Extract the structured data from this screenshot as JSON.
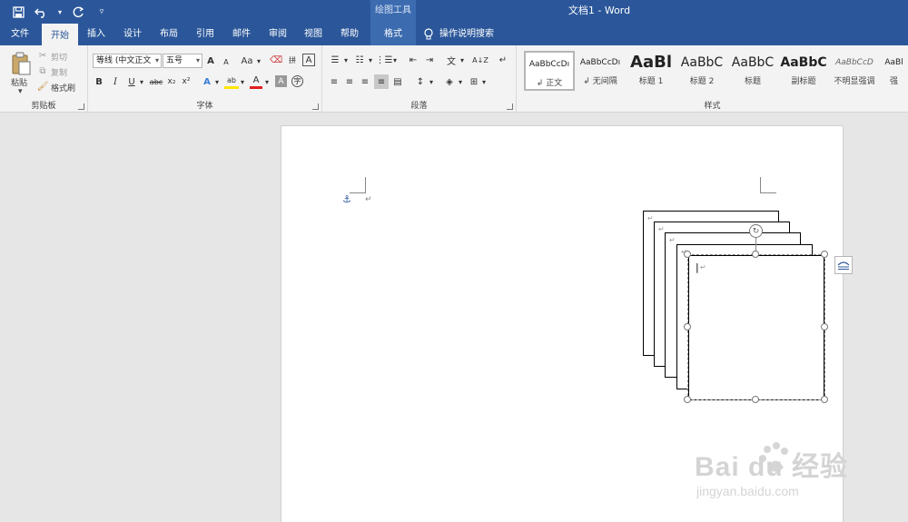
{
  "titlebar": {
    "context_group": "绘图工具",
    "doc_title": "文档1  -  Word"
  },
  "qat": {
    "save_icon": "save-icon",
    "undo_icon": "undo-icon",
    "redo_icon": "redo-icon",
    "customize_icon": "customize-qat-icon"
  },
  "tabs": [
    {
      "label": "文件"
    },
    {
      "label": "开始"
    },
    {
      "label": "插入"
    },
    {
      "label": "设计"
    },
    {
      "label": "布局"
    },
    {
      "label": "引用"
    },
    {
      "label": "邮件"
    },
    {
      "label": "审阅"
    },
    {
      "label": "视图"
    },
    {
      "label": "帮助"
    },
    {
      "label": "格式"
    }
  ],
  "tell_me": "操作说明搜索",
  "clipboard": {
    "paste": "粘贴",
    "cut": "剪切",
    "copy": "复制",
    "format_painter": "格式刷",
    "label": "剪贴板"
  },
  "font": {
    "font_name": "等线 (中文正文",
    "font_size": "五号",
    "grow": "A",
    "shrink": "A",
    "change_case": "Aa",
    "bold": "B",
    "italic": "I",
    "underline": "U",
    "strike": "abc",
    "subscript": "x₂",
    "superscript": "x²",
    "label": "字体"
  },
  "paragraph": {
    "label": "段落"
  },
  "styles": {
    "label": "样式",
    "items": [
      {
        "preview": "AaBbCcDı",
        "name": "↲ 正文"
      },
      {
        "preview": "AaBbCcDı",
        "name": "↲ 无间隔"
      },
      {
        "preview": "AaBl",
        "name": "标题 1"
      },
      {
        "preview": "AaBbC",
        "name": "标题 2"
      },
      {
        "preview": "AaBbC",
        "name": "标题"
      },
      {
        "preview": "AaBbC",
        "name": "副标题"
      },
      {
        "preview": "AaBbCcD",
        "name": "不明显强调"
      },
      {
        "preview": "AaBl",
        "name": "强"
      }
    ]
  },
  "document": {
    "paragraph_mark": "↵",
    "anchor_icon": "anchor-icon",
    "layout_options_icon": "layout-options-icon"
  },
  "watermark": {
    "brand": "Bai du 经验",
    "url": "jingyan.baidu.com"
  }
}
